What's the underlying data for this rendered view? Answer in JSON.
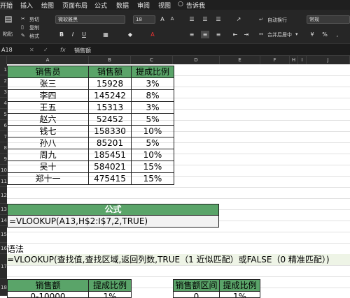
{
  "menu": {
    "items": [
      "开始",
      "插入",
      "绘图",
      "页面布局",
      "公式",
      "数据",
      "审阅",
      "视图",
      "告诉我"
    ]
  },
  "ribbon": {
    "paste": "粘贴",
    "cut": "剪切",
    "copy": "复制",
    "format": "格式",
    "font_name": "微软雅黑",
    "font_size": "18",
    "wrap": "自动换行",
    "merge": "合并后居中",
    "number_format": "常规"
  },
  "formula_bar": {
    "cell_ref": "A18",
    "fx": "fx",
    "content": "销售额"
  },
  "columns": [
    "A",
    "B",
    "C",
    "D",
    "E",
    "F",
    "H",
    "I",
    "J"
  ],
  "rows": [
    "1",
    "2",
    "3",
    "4",
    "5",
    "6",
    "7",
    "8",
    "9",
    "10",
    "11",
    "12",
    "13",
    "14",
    "15",
    "16",
    "17",
    "18"
  ],
  "table1": {
    "headers": [
      "销售员",
      "销售额",
      "提成比例"
    ],
    "rows": [
      [
        "张三",
        "15928",
        "3%"
      ],
      [
        "李四",
        "145242",
        "8%"
      ],
      [
        "王五",
        "15313",
        "3%"
      ],
      [
        "赵六",
        "52452",
        "5%"
      ],
      [
        "钱七",
        "158330",
        "10%"
      ],
      [
        "孙八",
        "85201",
        "5%"
      ],
      [
        "周九",
        "185451",
        "10%"
      ],
      [
        "吴十",
        "584021",
        "15%"
      ],
      [
        "郑十一",
        "475415",
        "15%"
      ]
    ]
  },
  "formula_box": {
    "title": "公式",
    "formula": "=VLOOKUP(A13,H$2:I$7,2,TRUE)"
  },
  "syntax": {
    "label": "语法",
    "text": "=VLOOKUP(查找值,查找区域,返回列数,TRUE（1 近似匹配）或FALSE（0 精准匹配）)"
  },
  "table2": {
    "headers": [
      "销售额",
      "提成比例"
    ],
    "partial_row": [
      "0-10000",
      "1%"
    ]
  },
  "table3": {
    "headers": [
      "销售额区间",
      "提成比例"
    ],
    "partial_row": [
      "0",
      "1%"
    ]
  },
  "colors": {
    "header_green": "#5aa469",
    "menu_bg": "#1f1f1f"
  }
}
